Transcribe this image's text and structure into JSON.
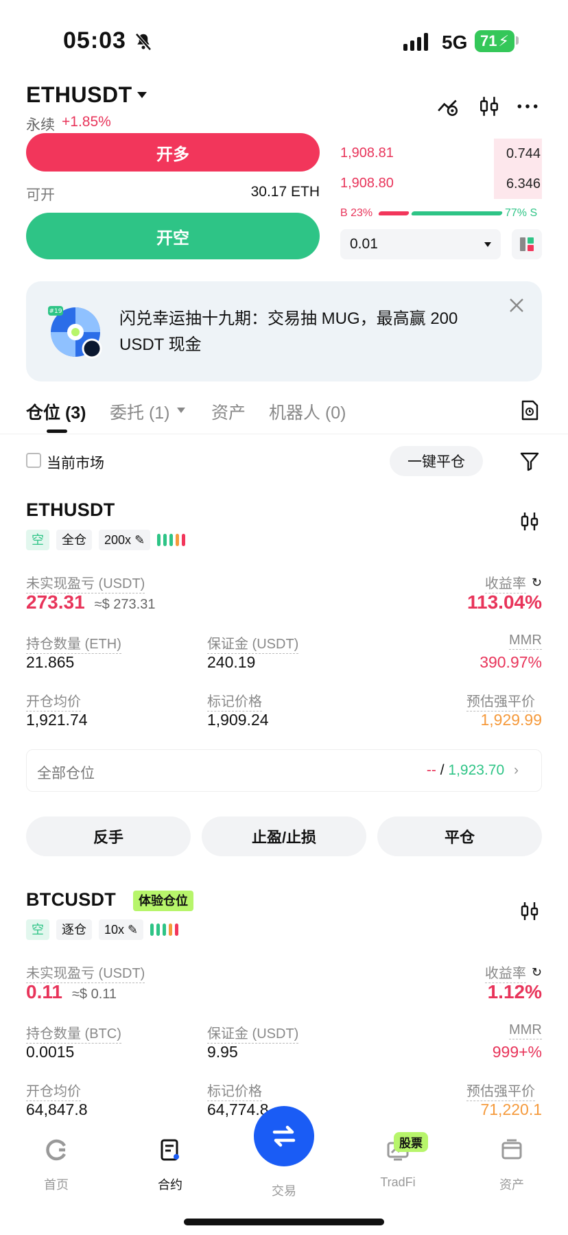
{
  "status_bar": {
    "time": "05:03",
    "network": "5G",
    "battery": "71"
  },
  "header": {
    "symbol": "ETHUSDT",
    "contract_type": "永续",
    "change": "+1.85%"
  },
  "trade_panel": {
    "long_label": "开多",
    "short_label": "开空",
    "available_label": "可开",
    "available_value": "30.17 ETH"
  },
  "order_book": {
    "asks": [
      {
        "price": "1,908.81",
        "size": "0.744"
      },
      {
        "price": "1,908.80",
        "size": "6.346"
      }
    ],
    "buy_ratio": "B 23%",
    "sell_ratio": "77% S",
    "buy_fraction": 0.23,
    "quantity": "0.01"
  },
  "banner": {
    "text": "闪兑幸运抽十九期：交易抽 MUG，最高赢 200 USDT 现金",
    "badge": "#19"
  },
  "tabs": [
    {
      "label": "仓位 (3)"
    },
    {
      "label": "委托 (1)"
    },
    {
      "label": "资产"
    },
    {
      "label": "机器人 (0)"
    }
  ],
  "filter": {
    "current_market": "当前市场",
    "close_all": "一键平仓"
  },
  "positions": [
    {
      "symbol": "ETHUSDT",
      "side": "空",
      "margin_mode": "全仓",
      "leverage": "200x",
      "pnl_label": "未实现盈亏 (USDT)",
      "pnl": "273.31",
      "pnl_approx": "≈$ 273.31",
      "roe_label": "收益率",
      "roe": "113.04%",
      "size_label": "持仓数量 (ETH)",
      "size": "21.865",
      "margin_label": "保证金 (USDT)",
      "margin": "240.19",
      "mmr_label": "MMR",
      "mmr": "390.97%",
      "entry_label": "开仓均价",
      "entry": "1,921.74",
      "mark_label": "标记价格",
      "mark": "1,909.24",
      "liq_label": "预估强平价",
      "liq": "1,929.99"
    },
    {
      "symbol": "BTCUSDT",
      "tag": "体验仓位",
      "side": "空",
      "margin_mode": "逐仓",
      "leverage": "10x",
      "pnl_label": "未实现盈亏 (USDT)",
      "pnl": "0.11",
      "pnl_approx": "≈$ 0.11",
      "roe_label": "收益率",
      "roe": "1.12%",
      "size_label": "持仓数量 (BTC)",
      "size": "0.0015",
      "margin_label": "保证金 (USDT)",
      "margin": "9.95",
      "mmr_label": "MMR",
      "mmr": "999+%",
      "entry_label": "开仓均价",
      "entry": "64,847.8",
      "mark_label": "标记价格",
      "mark": "64,774.8",
      "liq_label": "预估强平价",
      "liq": "71,220.1"
    }
  ],
  "all_positions": {
    "label": "全部仓位",
    "value_a": "--",
    "sep": "/",
    "value_b": "1,923.70"
  },
  "actions": {
    "reverse": "反手",
    "tpsl": "止盈/止损",
    "close": "平仓"
  },
  "nav": {
    "home": "首页",
    "futures": "合约",
    "trade": "交易",
    "tradfi": "TradFi",
    "tradfi_badge": "股票",
    "assets": "资产"
  },
  "colors": {
    "red": "#e8345a",
    "green": "#2ec486",
    "blue": "#1a5cf5",
    "orange": "#f59a3c"
  }
}
